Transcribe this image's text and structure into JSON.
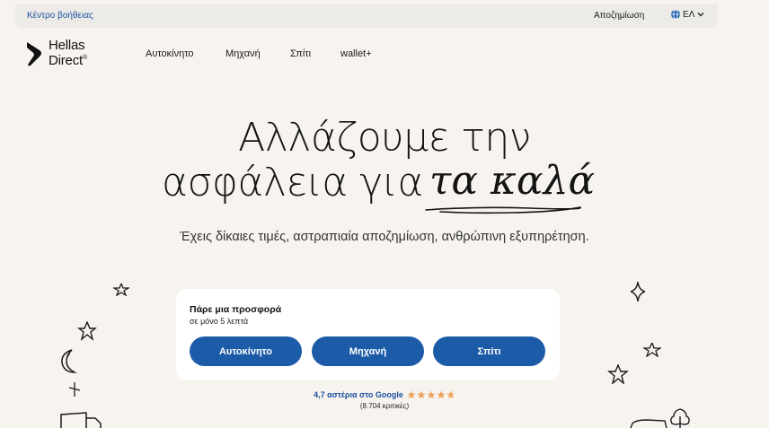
{
  "topbar": {
    "help_link": "Κέντρο βοήθειας",
    "claims_link": "Αποζημίωση",
    "language": "ΕΛ"
  },
  "logo": {
    "line1": "Hellas",
    "line2": "Direct",
    "reg": "®"
  },
  "nav": {
    "items": [
      {
        "label": "Αυτοκίνητο"
      },
      {
        "label": "Μηχανή"
      },
      {
        "label": "Σπίτι"
      },
      {
        "label": "wallet+"
      }
    ]
  },
  "hero": {
    "line1": "Αλλάζουμε την",
    "line2": "ασφάλεια για",
    "highlight": "τα καλά",
    "subtitle": "Έχεις δίκαιες τιμές, αστραπιαία αποζημίωση, ανθρώπινη εξυπηρέτηση."
  },
  "offer": {
    "title": "Πάρε μια προσφορά",
    "subtitle": "σε μόνο 5 λεπτά",
    "buttons": [
      {
        "label": "Αυτοκίνητο"
      },
      {
        "label": "Μηχανή"
      },
      {
        "label": "Σπίτι"
      }
    ]
  },
  "rating": {
    "text": "4,7 αστέρια στο Google",
    "stars": 4.7,
    "reviews": "(8.704 κριτικές)"
  },
  "colors": {
    "background": "#f7f4ef",
    "accent_blue": "#1c5ba8",
    "link_blue": "#1c4fa0",
    "star": "#f0a35e"
  }
}
